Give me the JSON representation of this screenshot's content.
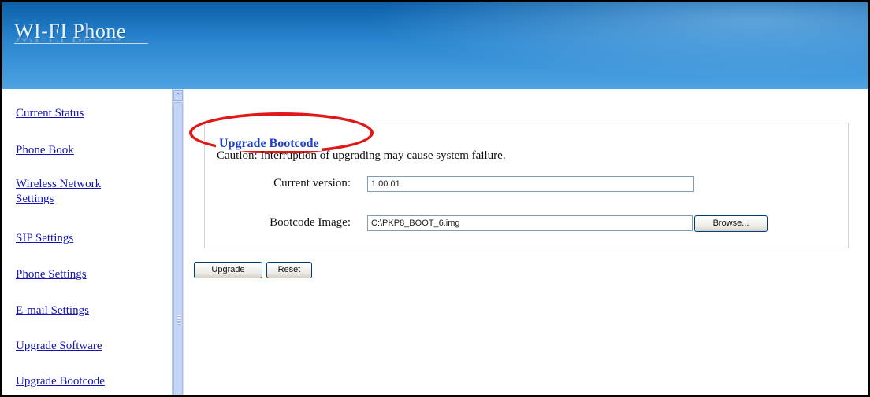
{
  "header": {
    "logo_text": "WI-FI Phone"
  },
  "nav": {
    "items": [
      {
        "label": "Current Status"
      },
      {
        "label": "Phone Book"
      },
      {
        "label": "Wireless Network"
      },
      {
        "label": "Settings"
      },
      {
        "label": "SIP Settings"
      },
      {
        "label": "Phone Settings"
      },
      {
        "label": "E-mail Settings"
      },
      {
        "label": "Upgrade Software"
      },
      {
        "label": "Upgrade Bootcode"
      }
    ]
  },
  "scrollbar": {
    "up_arrow": "^"
  },
  "form": {
    "legend": "Upgrade Bootcode",
    "caution": "Caution: Interruption of upgrading may cause system failure.",
    "current_version_label": "Current version:",
    "current_version_value": "1.00.01",
    "bootcode_image_label": "Bootcode Image:",
    "bootcode_image_value": "C:\\PKP8_BOOT_6.img",
    "browse_label": "Browse...",
    "upgrade_label": "Upgrade",
    "reset_label": "Reset"
  },
  "colors": {
    "header_blue": "#2a86cf",
    "link_blue": "#1414b0",
    "legend_blue": "#1f3fc8",
    "highlight_red": "#e01818"
  }
}
